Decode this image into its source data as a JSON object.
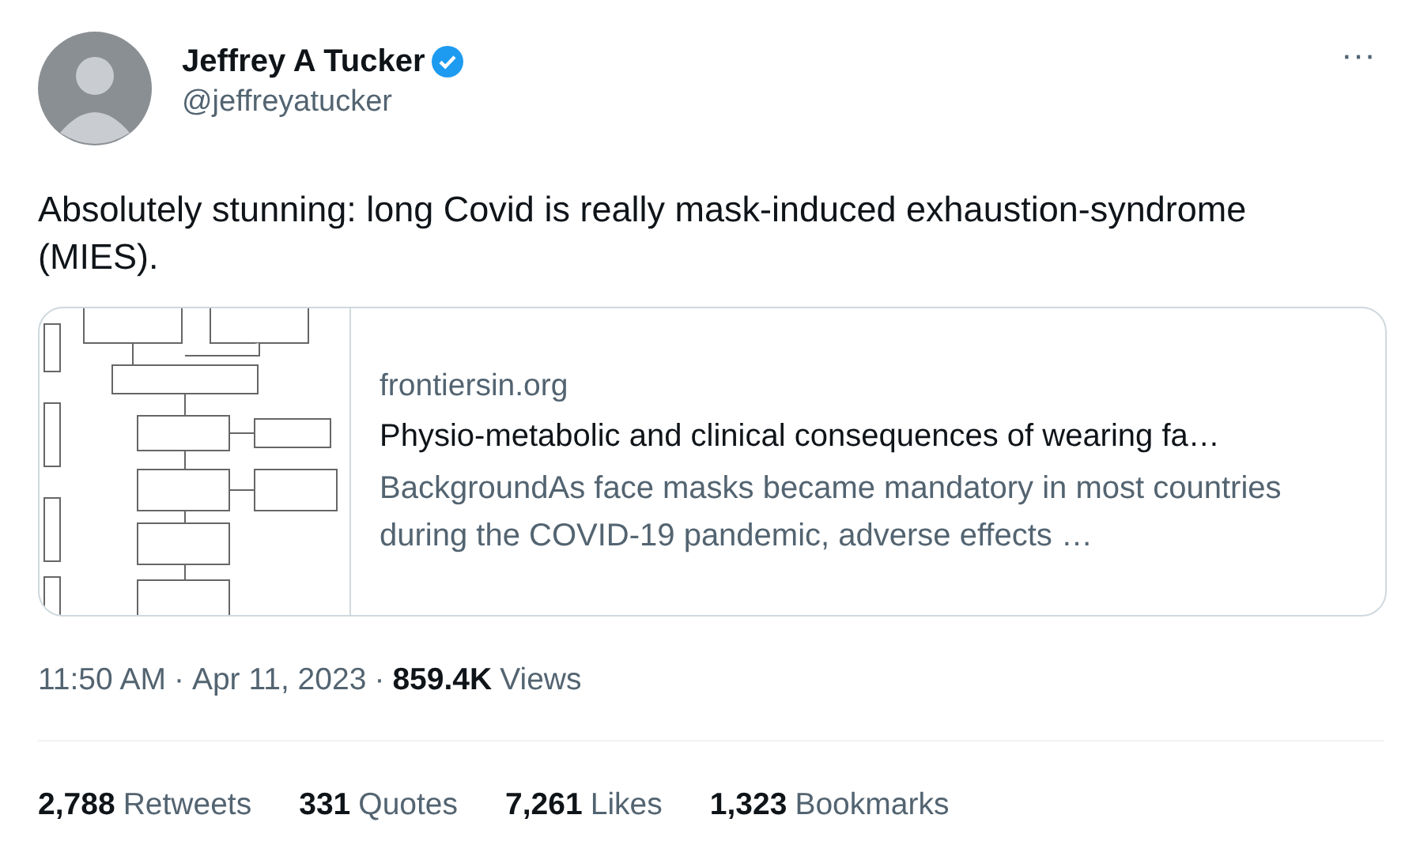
{
  "author": {
    "name": "Jeffrey A Tucker",
    "handle": "@jeffreyatucker",
    "verified": true
  },
  "more": "···",
  "text": "Absolutely stunning: long Covid is really mask-induced exhaustion-syndrome (MIES).",
  "card": {
    "domain": "frontiersin.org",
    "title": "Physio-metabolic and clinical consequences of wearing fa…",
    "description": "BackgroundAs face masks became mandatory in most countries during the COVID-19 pandemic, adverse effects …"
  },
  "meta": {
    "time": "11:50 AM",
    "separator_1": "·",
    "date": "Apr 11, 2023",
    "separator_2": "·",
    "views_count": "859.4K",
    "views_label": "Views"
  },
  "stats": [
    {
      "count": "2,788",
      "label": "Retweets"
    },
    {
      "count": "331",
      "label": "Quotes"
    },
    {
      "count": "7,261",
      "label": "Likes"
    },
    {
      "count": "1,323",
      "label": "Bookmarks"
    }
  ]
}
